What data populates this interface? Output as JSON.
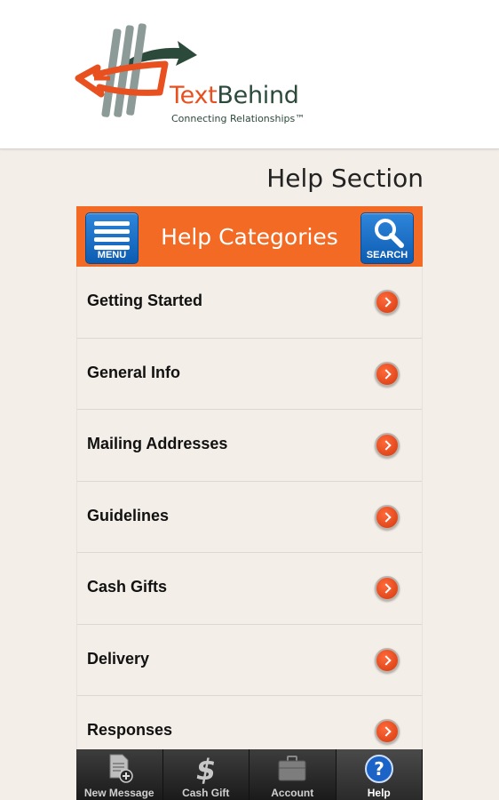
{
  "brand": {
    "name_part1": "Text",
    "name_part2": "Behind",
    "tagline": "Connecting Relationships™",
    "colors": {
      "orange": "#e8501f",
      "green": "#2c4a3b",
      "gray": "#8c9b98"
    }
  },
  "page": {
    "title": "Help Section"
  },
  "categories_bar": {
    "title": "Help Categories",
    "menu_label": "MENU",
    "search_label": "SEARCH",
    "color": "#f26a24"
  },
  "help_items": [
    {
      "label": "Getting Started"
    },
    {
      "label": "General Info"
    },
    {
      "label": "Mailing Addresses"
    },
    {
      "label": "Guidelines"
    },
    {
      "label": "Cash Gifts"
    },
    {
      "label": "Delivery"
    },
    {
      "label": "Responses"
    }
  ],
  "tabbar": {
    "items": [
      {
        "label": "New Message",
        "icon": "new-message-icon"
      },
      {
        "label": "Cash Gift",
        "icon": "cash-gift-icon"
      },
      {
        "label": "Account",
        "icon": "briefcase-icon"
      },
      {
        "label": "Help",
        "icon": "help-icon",
        "active": true
      }
    ]
  }
}
